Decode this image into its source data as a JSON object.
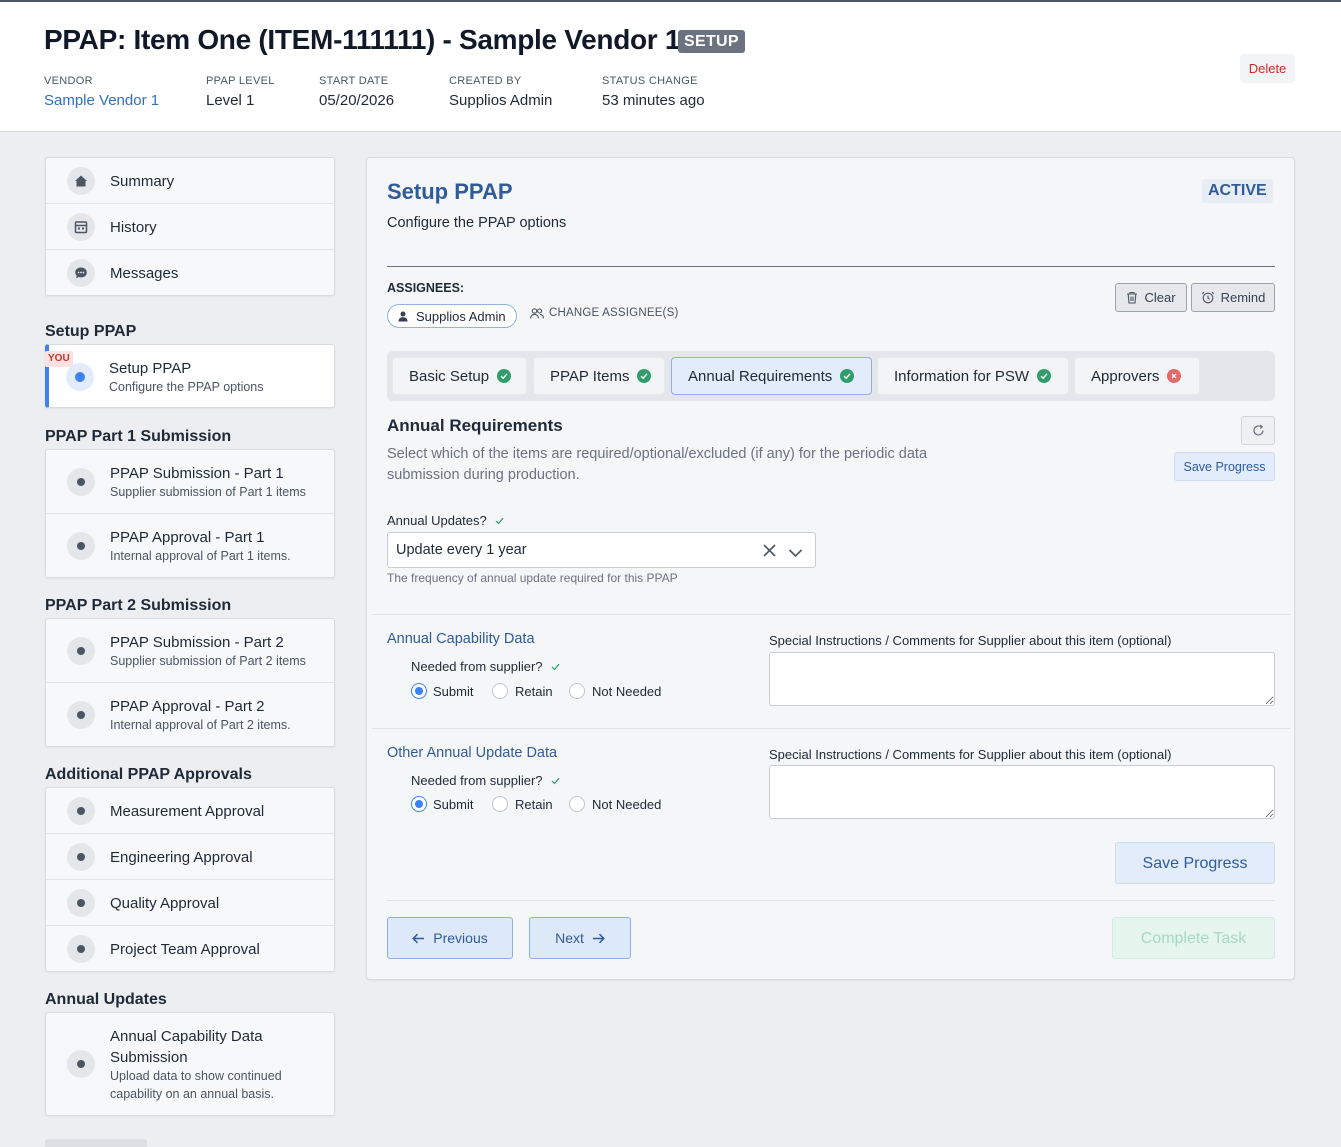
{
  "header": {
    "title": "PPAP: Item One (ITEM-111111) - Sample Vendor 1",
    "status_badge": "SETUP",
    "delete_label": "Delete",
    "meta": [
      {
        "label": "VENDOR",
        "value": "Sample Vendor 1"
      },
      {
        "label": "PPAP LEVEL",
        "value": "Level 1"
      },
      {
        "label": "START DATE",
        "value": "05/20/2026"
      },
      {
        "label": "CREATED BY",
        "value": "Supplios Admin"
      },
      {
        "label": "STATUS CHANGE",
        "value": "53 minutes ago"
      }
    ]
  },
  "sidebar": {
    "nav": [
      {
        "label": "Summary",
        "icon": "home-icon"
      },
      {
        "label": "History",
        "icon": "calendar-icon"
      },
      {
        "label": "Messages",
        "icon": "chat-icon"
      }
    ],
    "sections": [
      {
        "title": "Setup PPAP",
        "steps": [
          {
            "title": "Setup PPAP",
            "desc": "Configure the PPAP options",
            "current": true,
            "badge": "YOU"
          }
        ]
      },
      {
        "title": "PPAP Part 1 Submission",
        "steps": [
          {
            "title": "PPAP Submission - Part 1",
            "desc": "Supplier submission of Part 1 items"
          },
          {
            "title": "PPAP Approval - Part 1",
            "desc": "Internal approval of Part 1 items."
          }
        ]
      },
      {
        "title": "PPAP Part 2 Submission",
        "steps": [
          {
            "title": "PPAP Submission - Part 2",
            "desc": "Supplier submission of Part 2 items"
          },
          {
            "title": "PPAP Approval - Part 2",
            "desc": "Internal approval of Part 2 items."
          }
        ]
      },
      {
        "title": "Additional PPAP Approvals",
        "steps": [
          {
            "title": "Measurement Approval"
          },
          {
            "title": "Engineering Approval"
          },
          {
            "title": "Quality Approval"
          },
          {
            "title": "Project Team Approval"
          }
        ]
      },
      {
        "title": "Annual Updates",
        "steps": [
          {
            "title": "Annual Capability Data Submission",
            "title_line1": "Annual Capability Data",
            "title_line2": "Submission",
            "desc_line1": "Upload data to show continued",
            "desc_line2": "capability on an annual basis."
          }
        ]
      }
    ]
  },
  "main": {
    "title": "Setup PPAP",
    "status": "ACTIVE",
    "subtitle": "Configure the PPAP options",
    "assignees_label": "ASSIGNEES:",
    "assignee_name": "Supplios Admin",
    "change_assignees_label": "CHANGE ASSIGNEE(S)",
    "clear_label": "Clear",
    "remind_label": "Remind",
    "tabs": [
      {
        "label": "Basic Setup",
        "status": "complete"
      },
      {
        "label": "PPAP Items",
        "status": "complete"
      },
      {
        "label": "Annual Requirements",
        "status": "complete",
        "active": true
      },
      {
        "label": "Information for PSW",
        "status": "complete"
      },
      {
        "label": "Approvers",
        "status": "error"
      }
    ],
    "section_title": "Annual Requirements",
    "section_desc_line1": "Select which of the items are required/optional/excluded (if any) for the periodic data",
    "section_desc_line2": "submission during production.",
    "save_progress_small": "Save Progress",
    "annual_updates": {
      "label": "Annual Updates?",
      "value": "Update every 1 year",
      "help": "The frequency of annual update required for this PPAP"
    },
    "items": [
      {
        "title": "Annual Capability Data",
        "needed_label": "Needed from supplier?",
        "options": [
          "Submit",
          "Retain",
          "Not Needed"
        ],
        "selected": "Submit",
        "comments_label": "Special Instructions / Comments for Supplier about this item (optional)",
        "comments_value": ""
      },
      {
        "title": "Other Annual Update Data",
        "needed_label": "Needed from supplier?",
        "options": [
          "Submit",
          "Retain",
          "Not Needed"
        ],
        "selected": "Submit",
        "comments_label": "Special Instructions / Comments for Supplier about this item (optional)",
        "comments_value": ""
      }
    ],
    "save_progress_large": "Save Progress",
    "previous_label": "Previous",
    "next_label": "Next",
    "complete_label": "Complete Task"
  },
  "colors": {
    "accent": "#2f5c99",
    "link": "#2f6fbf",
    "success": "#2f9e6b",
    "error": "#e46a6a",
    "current_step": "#3b82f6"
  }
}
